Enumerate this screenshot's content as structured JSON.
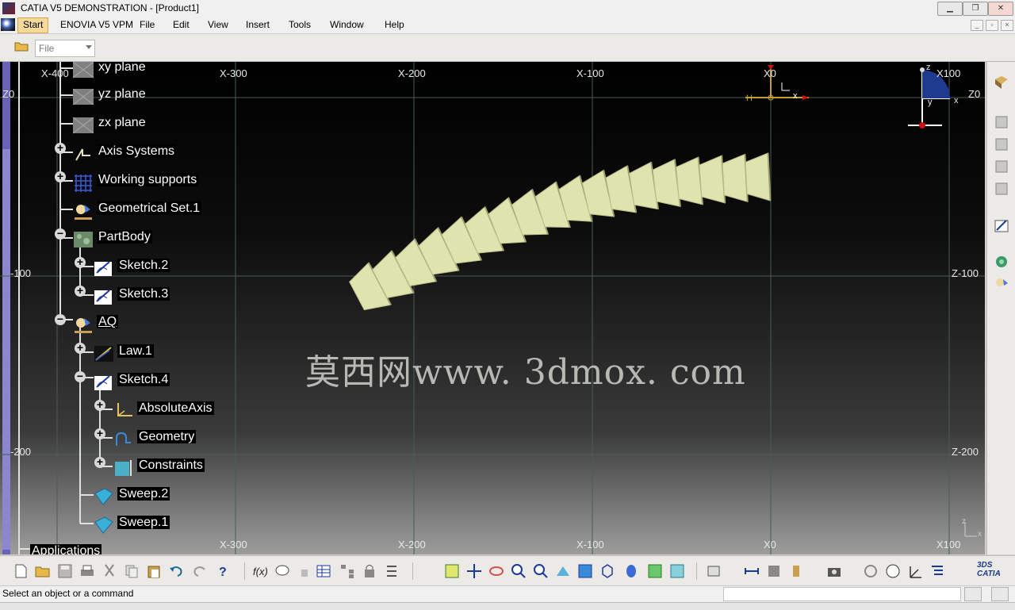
{
  "window": {
    "title": "CATIA V5 DEMONSTRATION - [Product1]",
    "minimize_icon": "minimize-icon",
    "maximize_icon": "restore-icon",
    "close_icon": "close-icon"
  },
  "menubar": {
    "items": [
      "Start",
      "ENOVIA V5 VPM",
      "File",
      "Edit",
      "View",
      "Insert",
      "Tools",
      "Window",
      "Help"
    ]
  },
  "top_toolbar": {
    "combo_value": "File"
  },
  "viewport": {
    "grid_labels_top": [
      "X-400",
      "X-300",
      "X-200",
      "X-100",
      "X0",
      "X100"
    ],
    "grid_labels_bottom": [
      "X-300",
      "X-200",
      "X-100",
      "X0",
      "X100"
    ],
    "grid_labels_left": [
      "Z0",
      "-100",
      "-200"
    ],
    "grid_labels_right": [
      "Z0",
      "Z-100",
      "Z-200"
    ],
    "watermark": "莫西网www. 3dmox. com",
    "colors": {
      "part": "#dfe3ae",
      "grid": "#5a6a6a",
      "background_top": "#000000",
      "background_bottom": "#9d9d9d"
    }
  },
  "tree": {
    "nodes": [
      {
        "label": "xy plane",
        "icon": "plane-icon"
      },
      {
        "label": "yz plane",
        "icon": "plane-icon"
      },
      {
        "label": "zx plane",
        "icon": "plane-icon"
      },
      {
        "label": "Axis Systems",
        "icon": "axis-system-icon"
      },
      {
        "label": "Working supports",
        "icon": "working-supports-icon"
      },
      {
        "label": "Geometrical Set.1",
        "icon": "geometrical-set-icon"
      },
      {
        "label": "PartBody",
        "icon": "part-body-icon"
      },
      {
        "label": "Sketch.2",
        "icon": "sketch-icon"
      },
      {
        "label": "Sketch.3",
        "icon": "sketch-icon"
      },
      {
        "label": "AQ",
        "icon": "geometrical-set-icon"
      },
      {
        "label": "Law.1",
        "icon": "law-icon"
      },
      {
        "label": "Sketch.4",
        "icon": "sketch-icon"
      },
      {
        "label": "AbsoluteAxis",
        "icon": "absolute-axis-icon"
      },
      {
        "label": "Geometry",
        "icon": "geometry-icon"
      },
      {
        "label": "Constraints",
        "icon": "constraints-icon"
      },
      {
        "label": "Sweep.2",
        "icon": "sweep-icon"
      },
      {
        "label": "Sweep.1",
        "icon": "sweep-icon"
      },
      {
        "label": "Applications",
        "icon": ""
      }
    ]
  },
  "statusbar": {
    "message": "Select an object or a command"
  }
}
